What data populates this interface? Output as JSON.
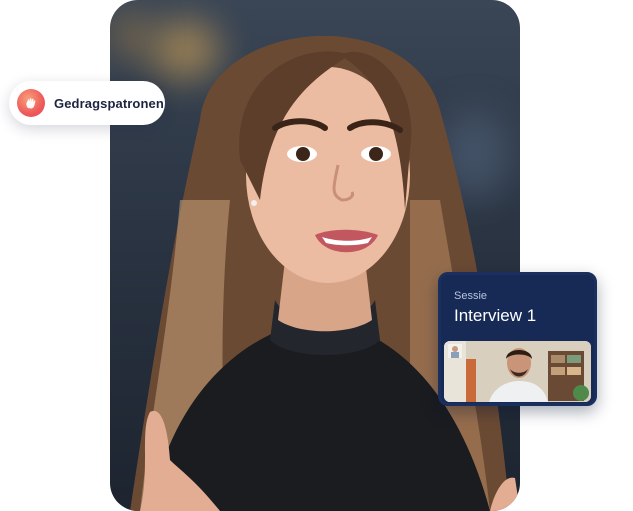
{
  "chip": {
    "label": "Gedragspatronen",
    "icon": "hand-icon",
    "icon_gradient": [
      "#f7a07a",
      "#e04859"
    ]
  },
  "session": {
    "label": "Sessie",
    "title": "Interview 1",
    "background": "#162a55"
  }
}
